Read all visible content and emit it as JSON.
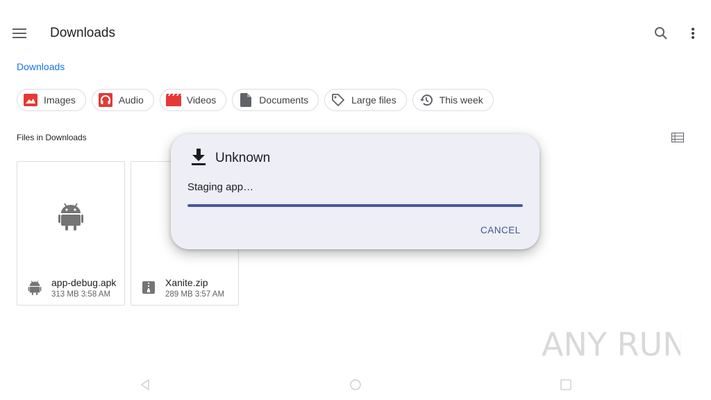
{
  "header": {
    "title": "Downloads"
  },
  "breadcrumb": "Downloads",
  "chips": [
    {
      "label": "Images",
      "icon": "image-icon",
      "color": "#e53935"
    },
    {
      "label": "Audio",
      "icon": "headphones-icon",
      "color": "#e53935"
    },
    {
      "label": "Videos",
      "icon": "movie-icon",
      "color": "#e53935"
    },
    {
      "label": "Documents",
      "icon": "document-icon",
      "color": "#5f6368"
    },
    {
      "label": "Large files",
      "icon": "tag-icon",
      "color": "#5f6368"
    },
    {
      "label": "This week",
      "icon": "history-icon",
      "color": "#5f6368"
    }
  ],
  "section": {
    "label": "Files in Downloads"
  },
  "files": [
    {
      "name": "app-debug.apk",
      "info": "313 MB 3:58 AM",
      "icon": "android-icon"
    },
    {
      "name": "Xanite.zip",
      "info": "289 MB 3:57 AM",
      "icon": "zip-icon"
    }
  ],
  "dialog": {
    "title": "Unknown",
    "message": "Staging app…",
    "progress": 1.0,
    "cancel_label": "CANCEL"
  },
  "watermark": "ANY RUN",
  "colors": {
    "accent": "#1a73e8",
    "dialog_bg": "#eeeef6",
    "progress": "#465a9c"
  }
}
